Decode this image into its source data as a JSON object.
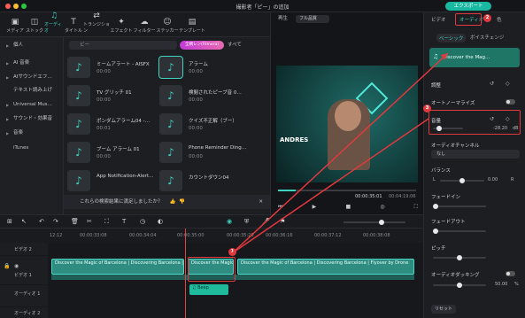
{
  "window": {
    "title": "撮影者「ピー」の追加",
    "export_label": "エクスポート"
  },
  "toolbar": [
    {
      "label": "メディア",
      "icon": "media-icon"
    },
    {
      "label": "ストック",
      "icon": "stock-icon"
    },
    {
      "label": "オーディオ",
      "icon": "music-icon"
    },
    {
      "label": "タイトル",
      "icon": "title-icon"
    },
    {
      "label": "トランジション",
      "icon": "transition-icon"
    },
    {
      "label": "エフェクト",
      "icon": "effect-icon"
    },
    {
      "label": "フィルター",
      "icon": "filter-icon"
    },
    {
      "label": "ステッカー",
      "icon": "sticker-icon"
    },
    {
      "label": "テンプレート",
      "icon": "template-icon"
    }
  ],
  "leftnav": [
    "個人",
    "AI 音楽",
    "AIサウンドエフ…",
    "テキスト読み上げ",
    "Universal Mus…",
    "サウンド・効果音",
    "音楽",
    "iTunes"
  ],
  "library": {
    "search_placeholder": "ビー",
    "pro_badge": "全網レン(Filmora)",
    "sort_label": "すべて",
    "items": [
      {
        "name": "ミームアラート - AISFX",
        "duration": "00:00"
      },
      {
        "name": "アラーム",
        "duration": "00:00"
      },
      {
        "name": "TV グリッチ 01",
        "duration": "00:00"
      },
      {
        "name": "検閲されたピープ音 0…",
        "duration": "00:00"
      },
      {
        "name": "ポンダムアラーム04 -…",
        "duration": "00:01"
      },
      {
        "name": "クイズ不正解（ブー）",
        "duration": "00:00"
      },
      {
        "name": "ブーム アラーム 01",
        "duration": "00:00"
      },
      {
        "name": "Phone Reminder Ding…",
        "duration": "00:00"
      },
      {
        "name": "App Notification-Alert…",
        "duration": ""
      },
      {
        "name": "カウントダウン04",
        "duration": ""
      }
    ],
    "feedback": "これらの検索結果に満足しましたか？"
  },
  "player": {
    "tab_label": "再生",
    "quality": "フル品質",
    "overlay_name": "ANDRES",
    "timecode_current": "00:00:35:01",
    "timecode_total": "00:04:19:06",
    "progress_fraction": 0.13
  },
  "rightpanel": {
    "tabs": [
      "ビデオ",
      "オーディオ",
      "色"
    ],
    "subtabs": [
      "ベーシック",
      "ボイスチェンジ"
    ],
    "clip_name": "Discover the Mag…",
    "adjust_label": "調整",
    "normalize_label": "オートノーマライズ",
    "volume_label": "音量",
    "volume_value": "-28.20",
    "volume_unit": "dB",
    "volume_fraction": 0.22,
    "channel_label": "オーディオチャンネル",
    "channel_value": "なし",
    "balance_label": "バランス",
    "balance_l": "L",
    "balance_value": "0.00",
    "balance_r": "R",
    "fadein_label": "フェードイン",
    "fadeout_label": "フェードアウト",
    "pitch_label": "ピッチ",
    "ducking_label": "オーディオダッキング",
    "ducking_value": "50.00",
    "ducking_unit": "%",
    "reset_label": "リセット"
  },
  "timeline": {
    "ruler": [
      "00:00:33:08",
      "00:00:34:04",
      "00:00:35:00",
      "00:00:35:20",
      "00:00:36:16",
      "00:00:37:12",
      "00:00:38:08"
    ],
    "ruler_left": "12:12",
    "track_video2": "ビデオ 2",
    "track_video1": "ビデオ 1",
    "track_audio": "オーディオ 1",
    "track_audio2": "オーディオ 2",
    "clip_label": "Discover the Magic of Barcelona | Discovering Barcelona | Flyover by Drone",
    "audio_clip_label": "Beep"
  },
  "annotations": [
    "1",
    "2",
    "3"
  ],
  "colors": {
    "accent": "#3fd1c0",
    "highlight": "#e0393e",
    "export": "#19b8a0"
  }
}
